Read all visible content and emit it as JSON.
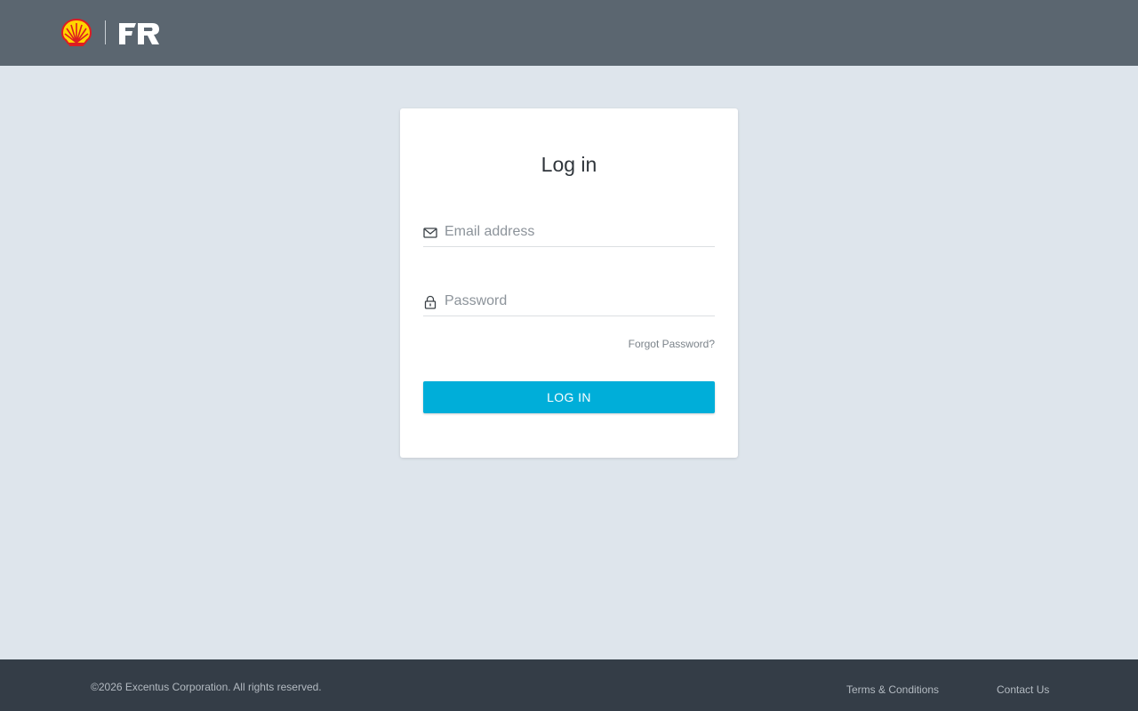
{
  "header": {
    "brand_logo_icon": "shell-pecten-icon",
    "secondary_logo_icon": "fr-logo-icon",
    "bg_color": "#5b6670"
  },
  "login": {
    "title": "Log in",
    "email": {
      "icon": "envelope-icon",
      "value": "",
      "placeholder": "Email address"
    },
    "password": {
      "icon": "lock-icon",
      "value": "",
      "placeholder": "Password"
    },
    "forgot_label": "Forgot Password?",
    "submit_label": "LOG IN",
    "accent_color": "#00aed9"
  },
  "footer": {
    "copyright": "©2026 Excentus Corporation. All rights reserved.",
    "links": [
      {
        "label": "Terms & Conditions"
      },
      {
        "label": "Contact Us"
      }
    ],
    "bg_color": "#343d47"
  }
}
